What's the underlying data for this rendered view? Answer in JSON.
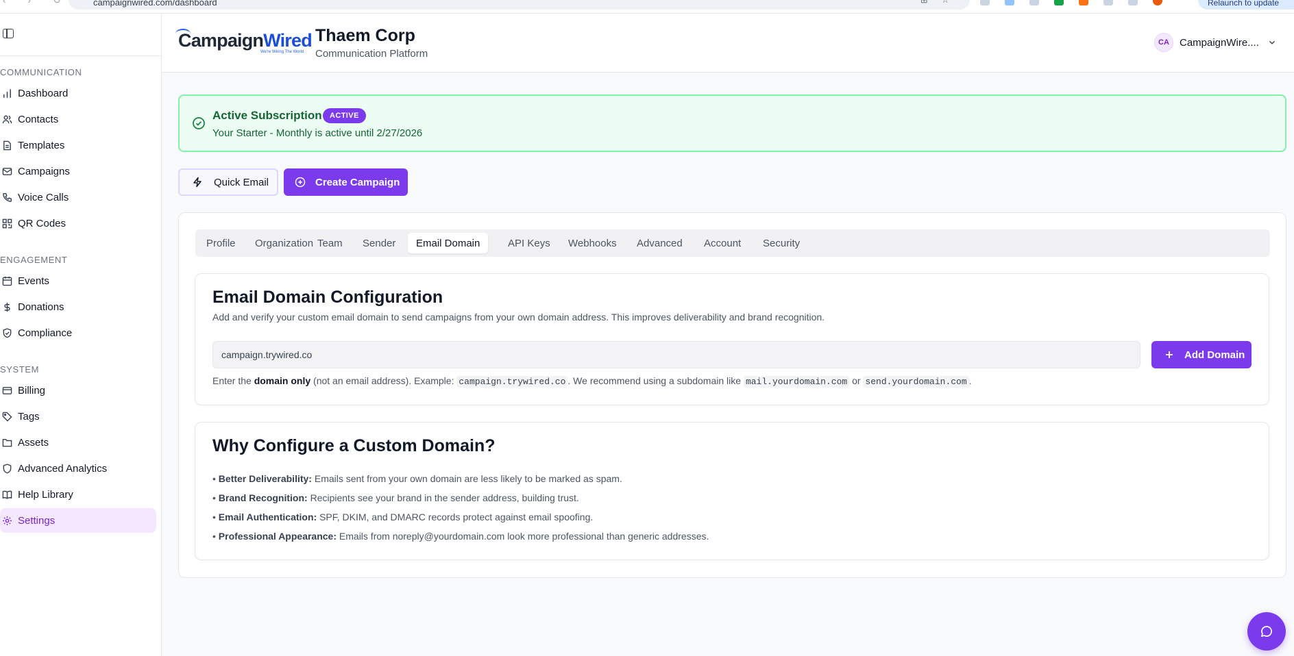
{
  "browser": {
    "url": "campaignwired.com/dashboard",
    "update_label": "Relaunch to update"
  },
  "brand": {
    "logo_part1": "Campaign",
    "logo_part2": "Wired",
    "logo_tagline": "We're Wiring The World",
    "accent_color": "#7c3aed"
  },
  "header": {
    "company": "Thaem Corp",
    "subtitle": "Communication Platform",
    "user_initials": "CA",
    "user_name": "CampaignWire...."
  },
  "sidebar": {
    "sections": {
      "communication": "COMMUNICATION",
      "engagement": "ENGAGEMENT",
      "system": "SYSTEM"
    },
    "items": [
      {
        "label": "Dashboard",
        "icon": "bar-chart-icon"
      },
      {
        "label": "Contacts",
        "icon": "users-icon"
      },
      {
        "label": "Templates",
        "icon": "file-text-icon"
      },
      {
        "label": "Campaigns",
        "icon": "mail-icon"
      },
      {
        "label": "Voice Calls",
        "icon": "phone-icon"
      },
      {
        "label": "QR Codes",
        "icon": "qr-code-icon"
      },
      {
        "label": "Events",
        "icon": "calendar-icon"
      },
      {
        "label": "Donations",
        "icon": "dollar-icon"
      },
      {
        "label": "Compliance",
        "icon": "shield-check-icon"
      },
      {
        "label": "Billing",
        "icon": "credit-card-icon"
      },
      {
        "label": "Tags",
        "icon": "tag-icon"
      },
      {
        "label": "Assets",
        "icon": "folder-icon"
      },
      {
        "label": "Advanced Analytics",
        "icon": "shield-icon"
      },
      {
        "label": "Help Library",
        "icon": "book-icon"
      },
      {
        "label": "Settings",
        "icon": "gear-icon",
        "active": true
      }
    ]
  },
  "subscription": {
    "title": "Active Subscription",
    "badge": "ACTIVE",
    "text": "Your Starter - Monthly is active until 2/27/2026"
  },
  "actions": {
    "quick_email": "Quick Email",
    "create_campaign": "Create Campaign"
  },
  "tabs": [
    "Profile",
    "Organization",
    "Team",
    "Sender",
    "Email Domain",
    "API Keys",
    "Webhooks",
    "Advanced",
    "Account",
    "Security"
  ],
  "active_tab": "Email Domain",
  "email_domain": {
    "title": "Email Domain Configuration",
    "description": "Add and verify your custom email domain to send campaigns from your own domain address. This improves deliverability and brand recognition.",
    "input_value": "campaign.trywired.co",
    "add_button": "Add Domain",
    "helper": {
      "p1": "Enter the ",
      "bold": "domain only",
      "p2": " (not an email address). Example: ",
      "code1": "campaign.trywired.co",
      "p3": ". We recommend using a subdomain like ",
      "code2": "mail.yourdomain.com",
      "p4": " or ",
      "code3": "send.yourdomain.com",
      "p5": "."
    }
  },
  "why": {
    "title": "Why Configure a Custom Domain?",
    "bullets": [
      {
        "label": "Better Deliverability:",
        "text": " Emails sent from your own domain are less likely to be marked as spam."
      },
      {
        "label": "Brand Recognition:",
        "text": " Recipients see your brand in the sender address, building trust."
      },
      {
        "label": "Email Authentication:",
        "text": " SPF, DKIM, and DMARC records protect against email spoofing."
      },
      {
        "label": "Professional Appearance:",
        "text": " Emails from noreply@yourdomain.com look more professional than generic addresses."
      }
    ]
  }
}
